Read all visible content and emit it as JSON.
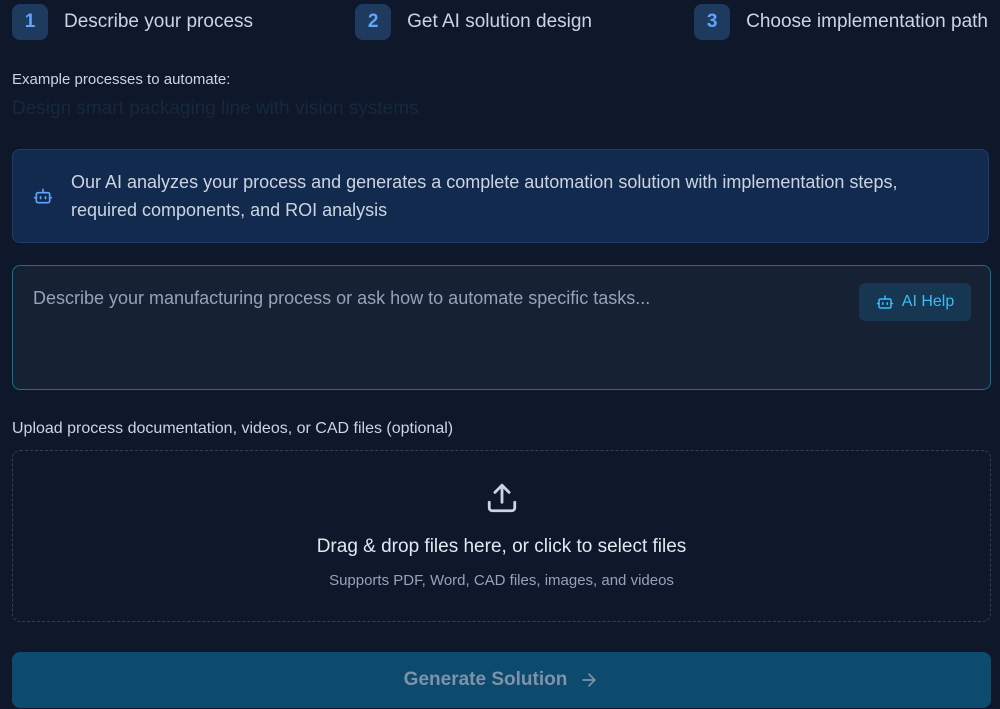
{
  "steps": [
    {
      "number": "1",
      "label": "Describe your process"
    },
    {
      "number": "2",
      "label": "Get AI solution design"
    },
    {
      "number": "3",
      "label": "Choose implementation path"
    }
  ],
  "examples": {
    "label": "Example processes to automate:",
    "current": "Design smart packaging line with vision systems"
  },
  "info": {
    "icon": "robot-icon",
    "text": "Our AI analyzes your process and generates a complete automation solution with implementation steps, required components, and ROI analysis"
  },
  "prompt": {
    "placeholder": "Describe your manufacturing process or ask how to automate specific tasks...",
    "help_label": "AI Help",
    "help_icon": "robot-icon"
  },
  "upload": {
    "label": "Upload process documentation, videos, or CAD files (optional)",
    "icon": "upload-icon",
    "title": "Drag & drop files here, or click to select files",
    "subtitle": "Supports PDF, Word, CAD files, images, and videos"
  },
  "generate": {
    "label": "Generate Solution",
    "icon": "arrow-right-icon"
  },
  "colors": {
    "background": "#0f172a",
    "accent": "#38bdf8",
    "step_badge": "#1e3a5f",
    "button": "#0c4a6e"
  }
}
